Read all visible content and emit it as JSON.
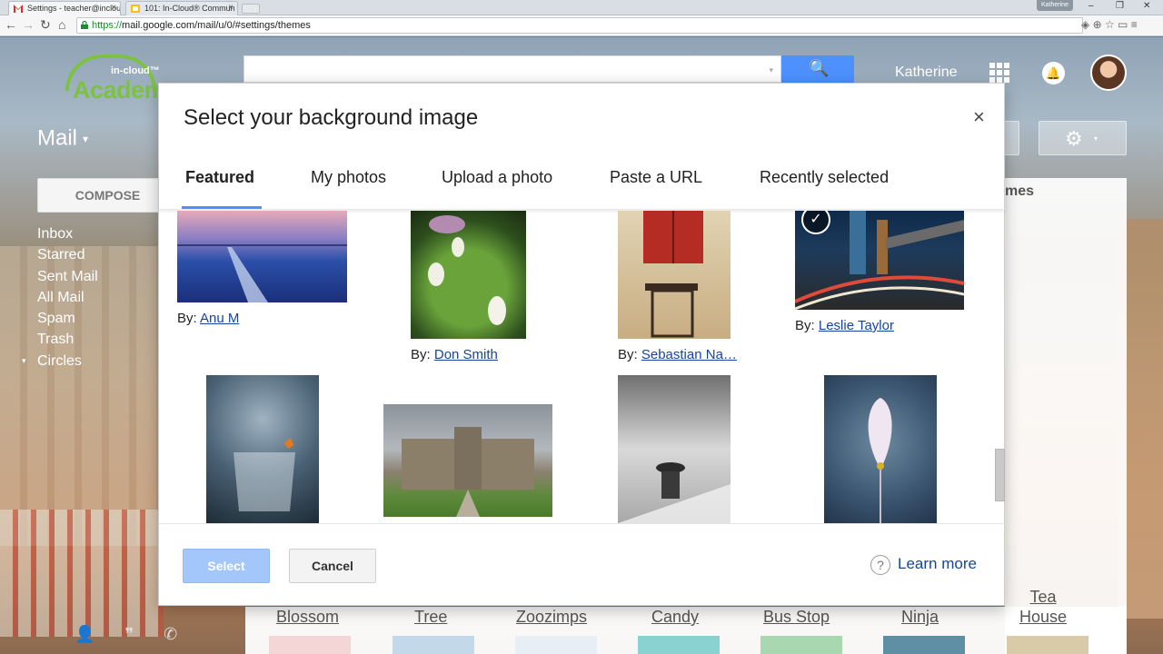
{
  "browser": {
    "tabs": [
      {
        "title": "Settings - teacher@inclou",
        "close": "×"
      },
      {
        "title": "101: In-Cloud® Commun",
        "close": "×"
      }
    ],
    "profile": "Katherine",
    "window_controls": {
      "minimize": "–",
      "restore": "❐",
      "close": "✕"
    },
    "url_proto": "https://",
    "url_rest": "mail.google.com/mail/u/0/#settings/themes",
    "nav": {
      "back": "←",
      "forward": "→",
      "reload": "↻",
      "home": "⌂"
    },
    "toolbar_icons": "◈ ⊕ ☆  ▭ ≡"
  },
  "gmail": {
    "logo_small": "in-cloud™",
    "logo_text": "Academy",
    "user_name": "Katherine",
    "bell_icon": "🔔",
    "mail_label": "Mail",
    "caret": "▾",
    "compose": "COMPOSE",
    "nav_items": [
      "Inbox",
      "Starred",
      "Sent Mail",
      "All Mail",
      "Spam",
      "Trash",
      "Circles"
    ],
    "themes_title": "mes",
    "search_icon": "🔍",
    "gear_icon": "⚙",
    "themes": [
      "Blossom",
      "Tree",
      "Zoozimps",
      "Candy",
      "Bus Stop",
      "Ninja",
      "Tea House"
    ],
    "hangout_icons": [
      "👤",
      "❞",
      "✆"
    ]
  },
  "dialog": {
    "title": "Select your background image",
    "close": "×",
    "tabs": [
      "Featured",
      "My photos",
      "Upload a photo",
      "Paste a URL",
      "Recently selected"
    ],
    "active_tab": "Featured",
    "photos": [
      {
        "by": "By:",
        "author": "Anu M"
      },
      {
        "by": "By:",
        "author": "Don Smith"
      },
      {
        "by": "By:",
        "author": "Sebastian Na…"
      },
      {
        "by": "By:",
        "author": "Leslie Taylor",
        "selected": true
      }
    ],
    "check_icon": "✓",
    "select_button": "Select",
    "cancel_button": "Cancel",
    "help_icon": "?",
    "learn_more": "Learn more"
  },
  "colors": {
    "accent": "#4d90fe",
    "link": "#15449e",
    "logo_green": "#7cc242"
  }
}
